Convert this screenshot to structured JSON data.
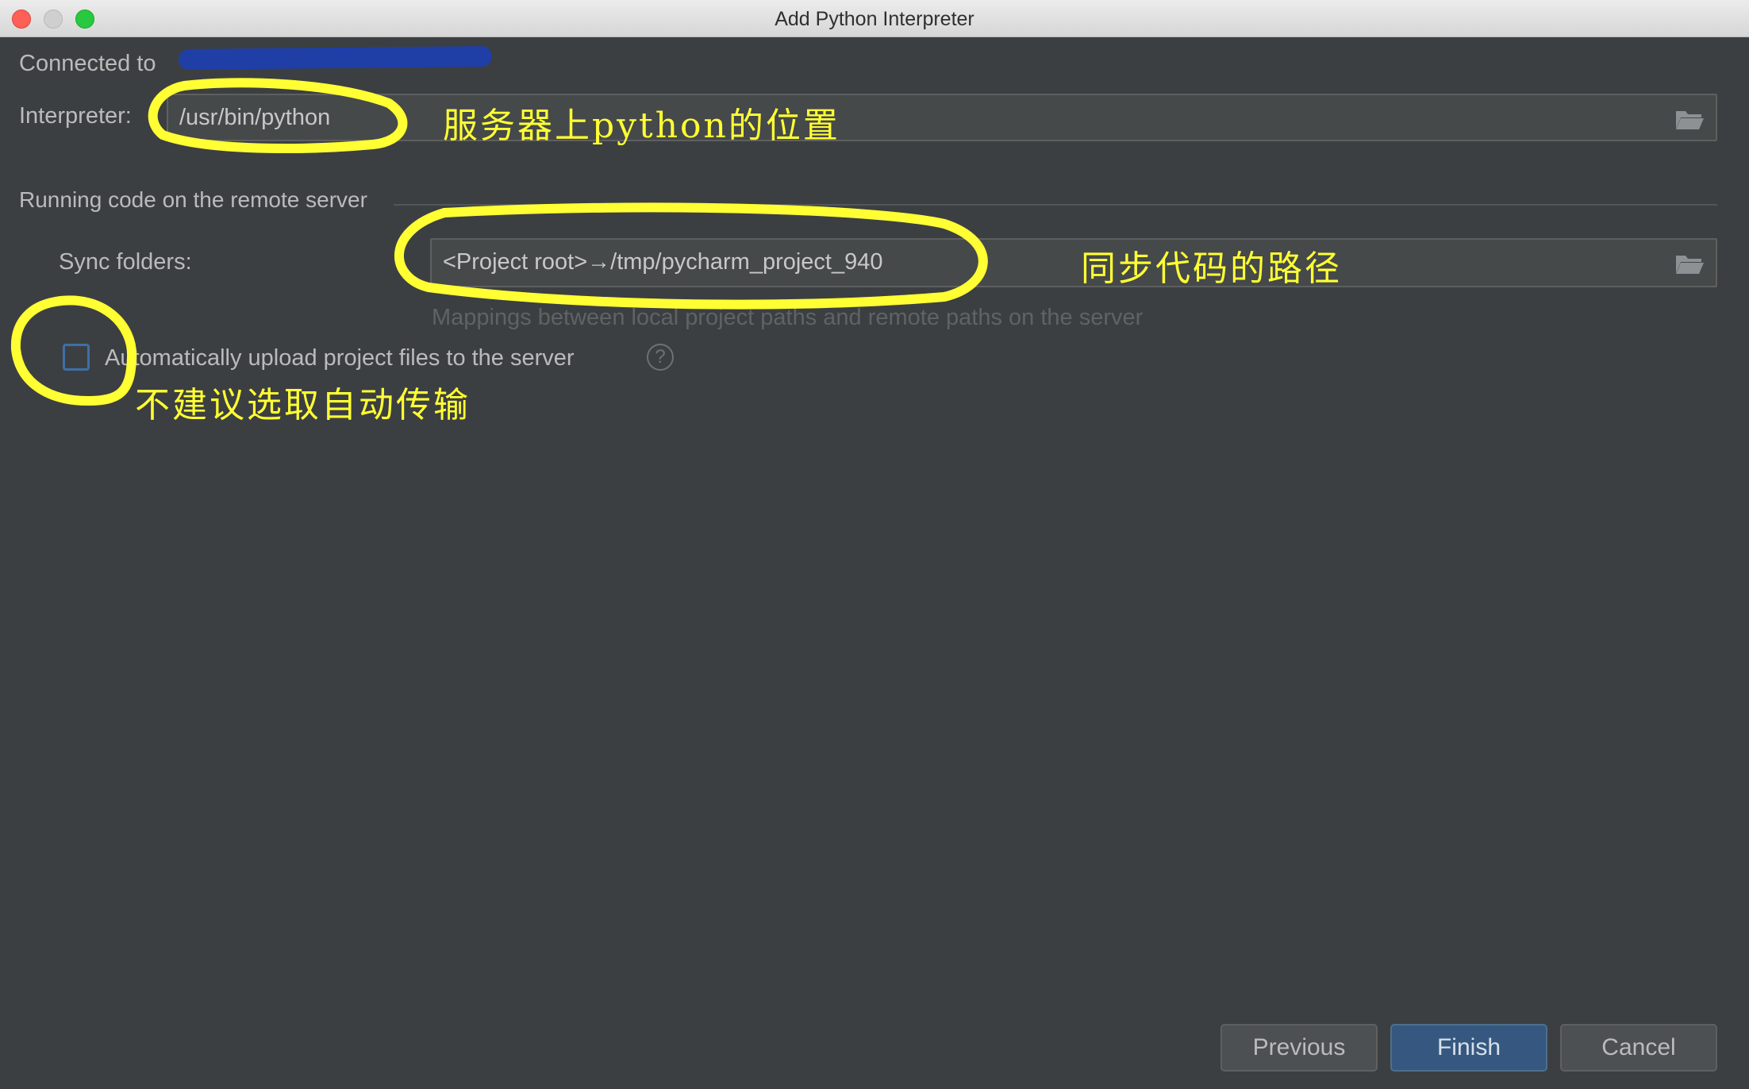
{
  "window": {
    "title": "Add Python Interpreter"
  },
  "connection": {
    "label": "Connected to"
  },
  "interpreter": {
    "label": "Interpreter:",
    "value": "/usr/bin/python",
    "browse_icon": "folder-icon"
  },
  "section": {
    "title": "Running code on the remote server"
  },
  "sync": {
    "label": "Sync folders:",
    "value": "<Project root>→/tmp/pycharm_project_940",
    "browse_icon": "folder-icon",
    "hint": "Mappings between local project paths and remote paths on the server"
  },
  "auto_upload": {
    "label": "Automatically upload project files to the server",
    "checked": false,
    "help_icon": "question-circle-icon",
    "help_glyph": "?"
  },
  "buttons": {
    "previous": "Previous",
    "finish": "Finish",
    "cancel": "Cancel"
  },
  "annotations": {
    "interpreter_note": "服务器上python的位置",
    "sync_note": "同步代码的路径",
    "upload_note": "不建议选取自动传输",
    "color": "#ffff33"
  },
  "colors": {
    "background": "#3c3f41",
    "field_background": "#45494a",
    "primary_button": "#365880",
    "checkbox_border": "#3e6fa9",
    "redaction": "#1f3fa6"
  }
}
